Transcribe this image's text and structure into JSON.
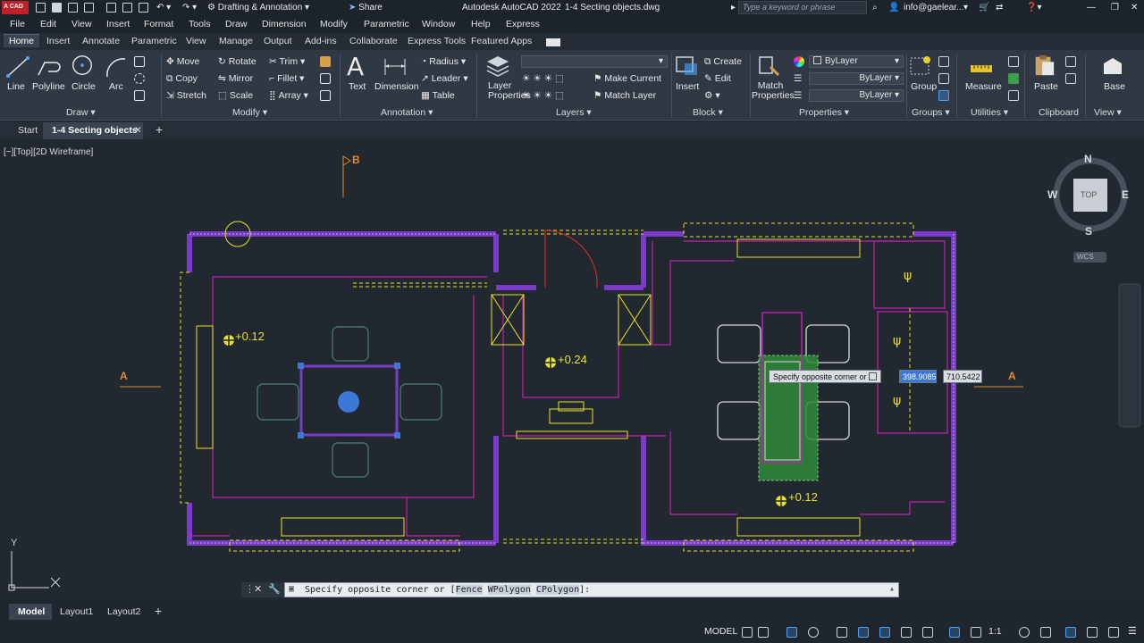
{
  "app": {
    "title": "Autodesk AutoCAD 2022",
    "file": "1-4 Secting objects.dwg",
    "workspace": "Drafting & Annotation",
    "share": "Share",
    "search_placeholder": "Type a keyword or phrase",
    "user": "info@gaelear...",
    "logo": "A CAD"
  },
  "menu": [
    "File",
    "Edit",
    "View",
    "Insert",
    "Format",
    "Tools",
    "Draw",
    "Dimension",
    "Modify",
    "Parametric",
    "Window",
    "Help",
    "Express"
  ],
  "ribbon_tabs": [
    "Home",
    "Insert",
    "Annotate",
    "Parametric",
    "View",
    "Manage",
    "Output",
    "Add-ins",
    "Collaborate",
    "Express Tools",
    "Featured Apps"
  ],
  "ribbon": {
    "draw": {
      "label": "Draw",
      "tools": [
        "Line",
        "Polyline",
        "Circle",
        "Arc"
      ]
    },
    "modify": {
      "label": "Modify",
      "tools": [
        "Move",
        "Rotate",
        "Trim",
        "Copy",
        "Mirror",
        "Fillet",
        "Stretch",
        "Scale",
        "Array"
      ]
    },
    "annotation": {
      "label": "Annotation",
      "tools": [
        "Text",
        "Dimension",
        "Radius",
        "Leader",
        "Table"
      ]
    },
    "layers": {
      "label": "Layers",
      "tools": [
        "Layer Properties",
        "Make Current",
        "Match Layer"
      ]
    },
    "block": {
      "label": "Block",
      "tools": [
        "Insert",
        "Create",
        "Edit"
      ]
    },
    "properties": {
      "label": "Properties",
      "tools": [
        "Match Properties"
      ],
      "values": [
        "ByLayer",
        "ByLayer",
        "ByLayer"
      ]
    },
    "groups": {
      "label": "Groups",
      "tools": [
        "Group"
      ]
    },
    "utilities": {
      "label": "Utilities",
      "tools": [
        "Measure"
      ]
    },
    "clipboard": {
      "label": "Clipboard",
      "tools": [
        "Paste"
      ]
    },
    "view": {
      "label": "View",
      "tools": [
        "Base"
      ]
    }
  },
  "doc_tabs": [
    "Start",
    "1-4 Secting objects"
  ],
  "viewport": {
    "label": "[−][Top][2D Wireframe]",
    "viewcube": {
      "n": "N",
      "s": "S",
      "e": "E",
      "w": "W",
      "face": "TOP",
      "ucs": "WCS"
    },
    "section_marks": [
      "B",
      "A",
      "A"
    ],
    "levels": [
      "+0.12",
      "+0.24",
      "+0.12"
    ],
    "ucs": {
      "y": "Y"
    }
  },
  "tooltip": {
    "text": "Specify opposite corner or",
    "x": "398.9085",
    "y": "710.5422"
  },
  "command": {
    "prompt": "Specify opposite corner or [",
    "options": [
      "Fence",
      "WPolygon",
      "CPolygon"
    ],
    "end": "]:"
  },
  "layout_tabs": [
    "Model",
    "Layout1",
    "Layout2"
  ],
  "status": {
    "model": "MODEL",
    "scale": "1:1"
  },
  "colors": {
    "wall": "#7a3cc8",
    "yellow": "#e7e12a",
    "magenta": "#c21fb0",
    "selection": "#2e8b3a",
    "background": "#212830"
  }
}
